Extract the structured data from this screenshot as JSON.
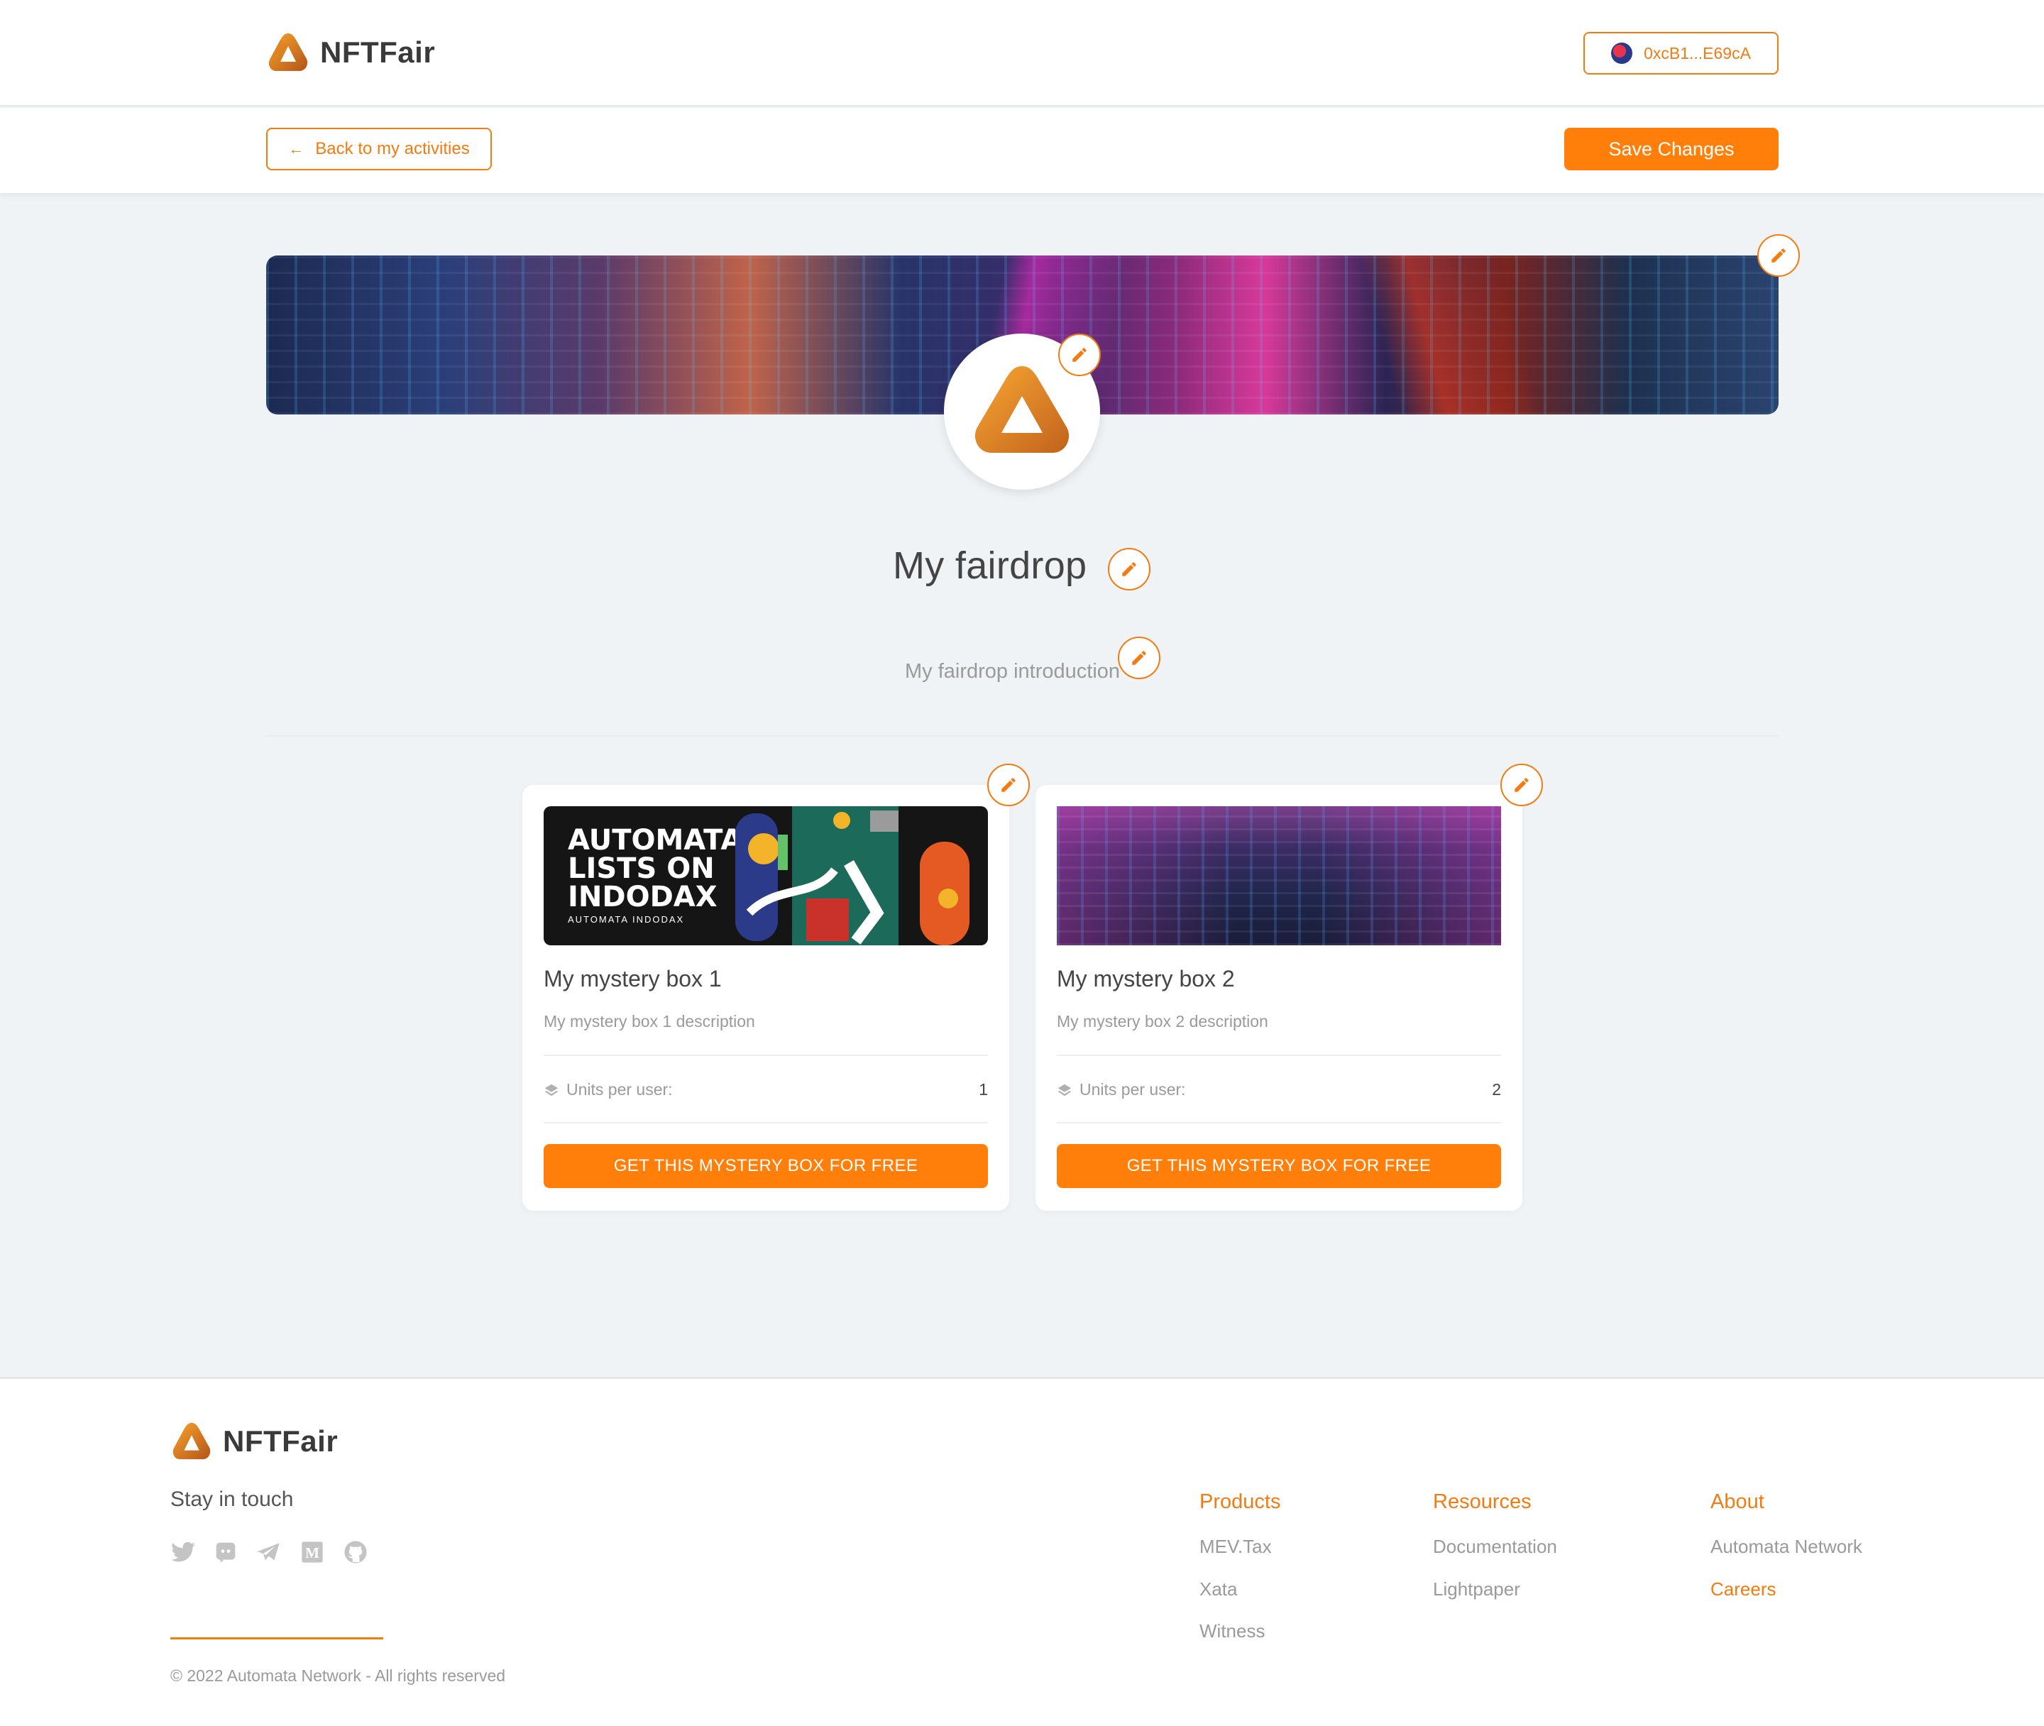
{
  "brand": {
    "name": "NFTFair"
  },
  "header": {
    "wallet_address": "0xcB1...E69cA"
  },
  "toolbar": {
    "back_label": "Back to my activities",
    "save_label": "Save Changes"
  },
  "fairdrop": {
    "title": "My fairdrop",
    "introduction": "My fairdrop introduction"
  },
  "boxes": [
    {
      "title": "My mystery box 1",
      "description": "My mystery box 1 description",
      "units_label": "Units per user:",
      "units_value": "1",
      "cta": "GET THIS MYSTERY BOX FOR FREE",
      "image_text": "AUTOMATA LISTS ON INDODAX",
      "image_subtext": "AUTOMATA  INDODAX"
    },
    {
      "title": "My mystery box 2",
      "description": "My mystery box 2 description",
      "units_label": "Units per user:",
      "units_value": "2",
      "cta": "GET THIS MYSTERY BOX FOR FREE"
    }
  ],
  "footer": {
    "stay_in_touch": "Stay in touch",
    "social_icons": [
      "twitter-icon",
      "discord-icon",
      "telegram-icon",
      "medium-icon",
      "github-icon"
    ],
    "columns": [
      {
        "heading": "Products",
        "links": [
          "MEV.Tax",
          "Xata",
          "Witness"
        ]
      },
      {
        "heading": "Resources",
        "links": [
          "Documentation",
          "Lightpaper"
        ]
      },
      {
        "heading": "About",
        "links": [
          "Automata Network",
          "Careers"
        ]
      }
    ],
    "copyright": "© 2022 Automata Network - All rights reserved"
  },
  "colors": {
    "accent": "#FF7F0A",
    "background": "#F0F3F6",
    "text": "#444444",
    "muted": "#9A9A9A"
  }
}
